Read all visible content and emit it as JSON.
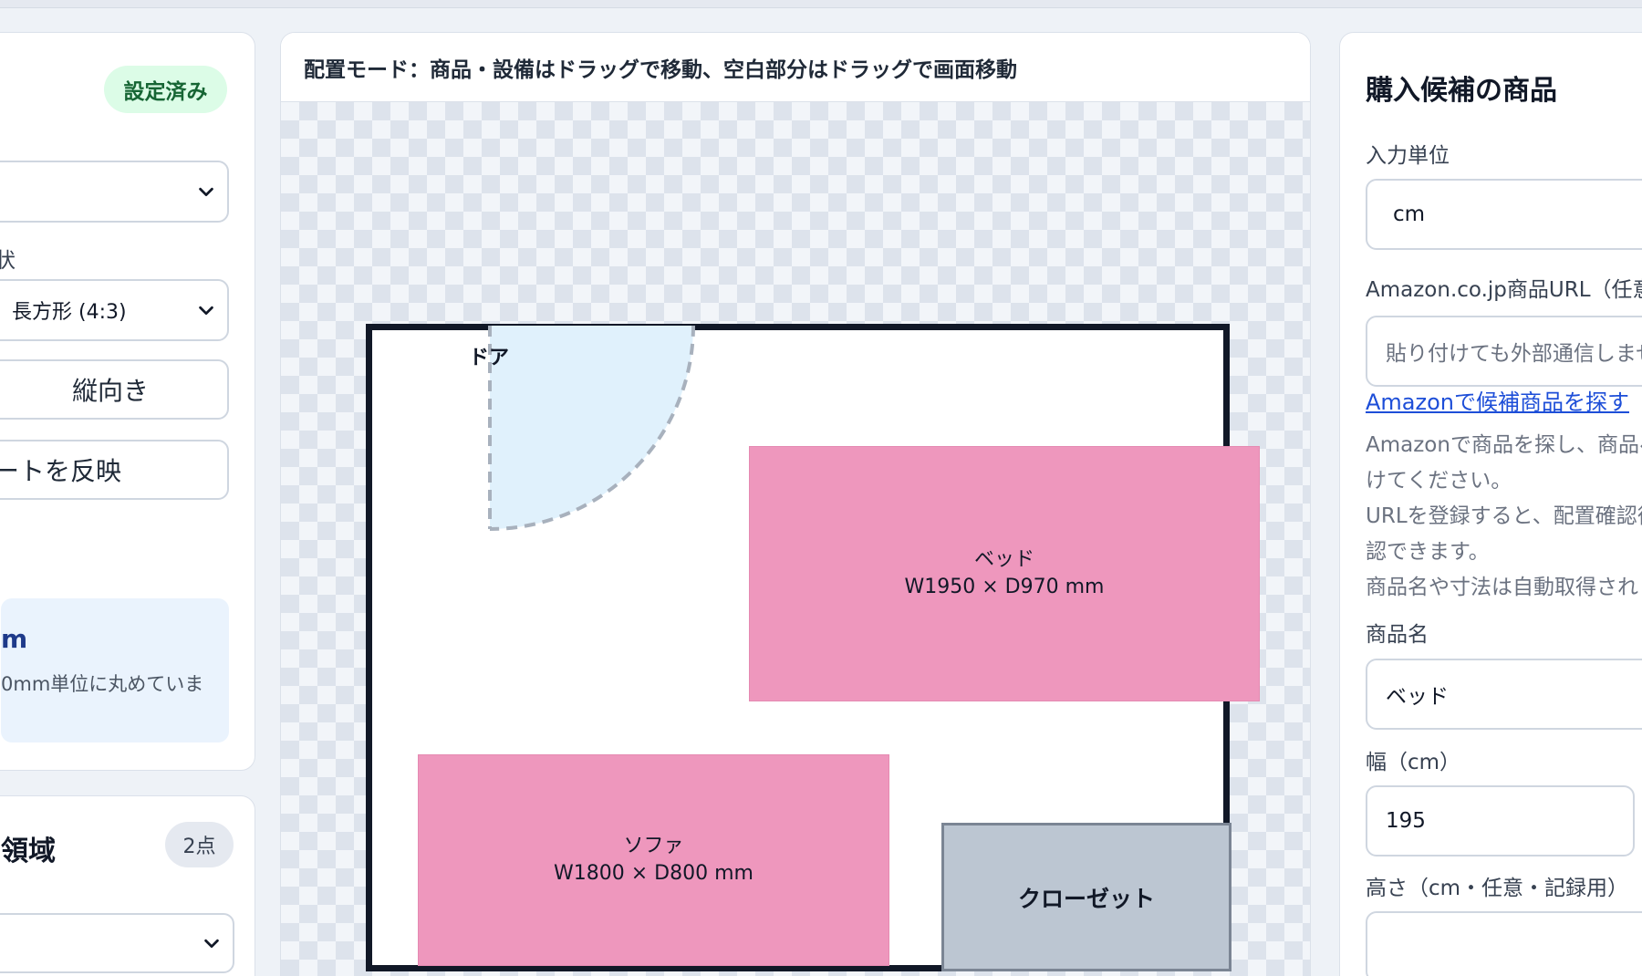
{
  "left_panel": {
    "status_badge": "設定済み",
    "shape_label": "形状",
    "shape_select_value": "長方形 (4:3)",
    "orientation_button": "縦向き",
    "apply_button": "ートを反映",
    "info_title": "m",
    "info_note": "0mm単位に丸めていま",
    "section2_title": "領域",
    "section2_badge": "2点"
  },
  "center_panel": {
    "mode_text": "配置モード：商品・設備はドラッグで移動、空白部分はドラッグで画面移動",
    "room": {
      "door_label": "ドア",
      "items": [
        {
          "name": "ベッド",
          "dims": "W1950 × D970 mm"
        },
        {
          "name": "ソファ",
          "dims": "W1800 × D800 mm"
        }
      ],
      "closet_label": "クローゼット"
    }
  },
  "right_panel": {
    "title": "購入候補の商品",
    "unit_label": "入力単位",
    "unit_value": "cm",
    "url_label": "Amazon.co.jp商品URL（任意",
    "url_placeholder": "貼り付けても外部通信しませ",
    "search_link": "Amazonで候補商品を探す",
    "help_lines": [
      "Amazonで商品を探し、商品ペ",
      "けてください。",
      "URLを登録すると、配置確認後",
      "認できます。",
      "商品名や寸法は自動取得され"
    ],
    "name_label": "商品名",
    "name_value": "ベッド",
    "width_label": "幅（cm）",
    "width_value": "195",
    "height_label": "高さ（cm・任意・記録用）",
    "height_value": ""
  },
  "colors": {
    "furniture": "#ee97bd",
    "closet": "#bcc6d2",
    "door_swing": "#e0f1fc",
    "link": "#1d4ed8",
    "badge_success_bg": "#dcfce7"
  },
  "icons": [
    "chevron-down-icon"
  ]
}
